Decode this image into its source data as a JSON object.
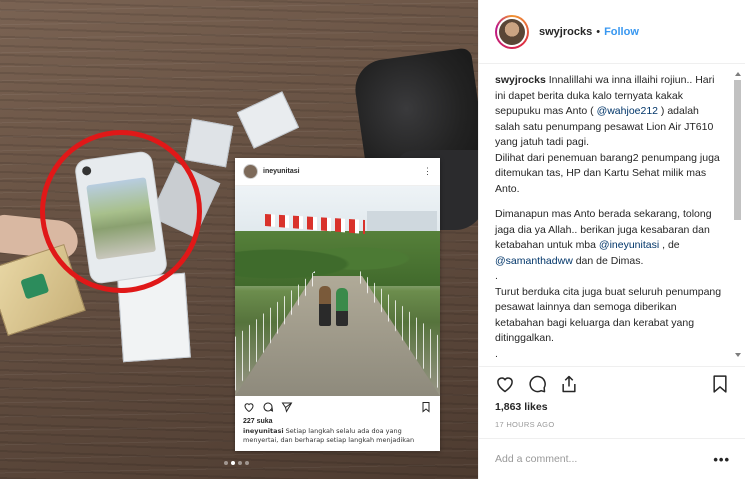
{
  "post": {
    "username": "swyjrocks",
    "separator": "•",
    "follow_label": "Follow",
    "caption": {
      "author": "swyjrocks",
      "paragraph1_a": " Innalillahi wa inna illaihi rojiun.. Hari ini dapet berita duka kalo ternyata kakak sepupuku mas Anto ( ",
      "mention1": "@wahjoe212",
      "paragraph1_b": " ) adalah salah satu penumpang pesawat Lion Air JT610 yang jatuh tadi pagi.\nDilihat dari penemuan barang2 penumpang juga ditemukan tas, HP dan Kartu Sehat milik mas Anto.",
      "paragraph2_a": "Dimanapun mas Anto berada sekarang, tolong jaga dia ya Allah.. berikan juga kesabaran dan ketabahan untuk mba ",
      "mention2": "@ineyunitasi",
      "paragraph2_b": " , de ",
      "mention3": "@samanthadww",
      "paragraph2_c": " dan de Dimas.",
      "dot1": ".",
      "paragraph3": "Turut berduka cita juga buat seluruh penumpang pesawat lainnya dan semoga diberikan ketabahan bagi keluarga dan kerabat yang ditinggalkan.",
      "dot2": "."
    },
    "likes": "1,863 likes",
    "timestamp": "17 HOURS AGO",
    "comment_placeholder": "Add a comment...",
    "more_label": "•••"
  },
  "inner_post": {
    "username": "ineyunitasi",
    "more": "⋮",
    "likes": "227 suka",
    "caption_user": "ineyunitasi",
    "caption_text": " Setiap langkah selalu ada doa yang menyertai, dan berharap setiap langkah menjadikan"
  },
  "carousel": {
    "count": 4,
    "active": 1
  },
  "colors": {
    "link": "#3897f0",
    "mention": "#003569",
    "circle": "#e01818"
  },
  "icons": [
    "heart-icon",
    "comment-icon",
    "share-icon",
    "bookmark-icon"
  ]
}
